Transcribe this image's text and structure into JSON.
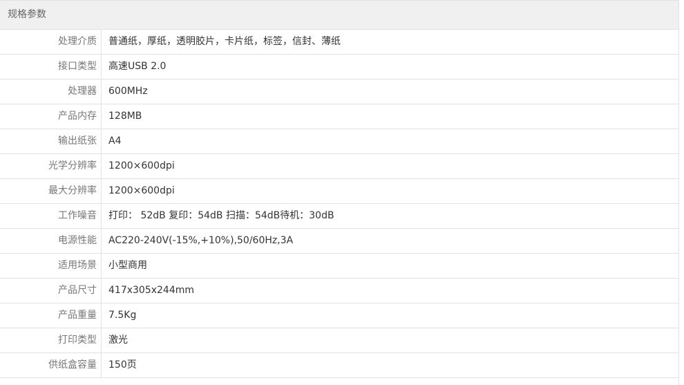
{
  "spec": {
    "title": "规格参数",
    "rows": [
      {
        "label": "处理介质",
        "value": "普通纸，厚纸，透明胶片，卡片纸，标签，信封、薄纸"
      },
      {
        "label": "接口类型",
        "value": "高速USB 2.0"
      },
      {
        "label": "处理器",
        "value": "600MHz"
      },
      {
        "label": "产品内存",
        "value": "128MB"
      },
      {
        "label": "输出纸张",
        "value": "A4"
      },
      {
        "label": "光学分辨率",
        "value": "1200×600dpi"
      },
      {
        "label": "最大分辨率",
        "value": "1200×600dpi"
      },
      {
        "label": "工作噪音",
        "value": "打印： 52dB 复印：54dB 扫描：54dB待机：30dB"
      },
      {
        "label": "电源性能",
        "value": "AC220-240V(-15%,+10%),50/60Hz,3A"
      },
      {
        "label": "适用场景",
        "value": "小型商用"
      },
      {
        "label": "产品尺寸",
        "value": "417x305x244mm"
      },
      {
        "label": "产品重量",
        "value": "7.5Kg"
      },
      {
        "label": "打印类型",
        "value": "激光"
      },
      {
        "label": "供纸盒容量",
        "value": "150页"
      }
    ]
  }
}
